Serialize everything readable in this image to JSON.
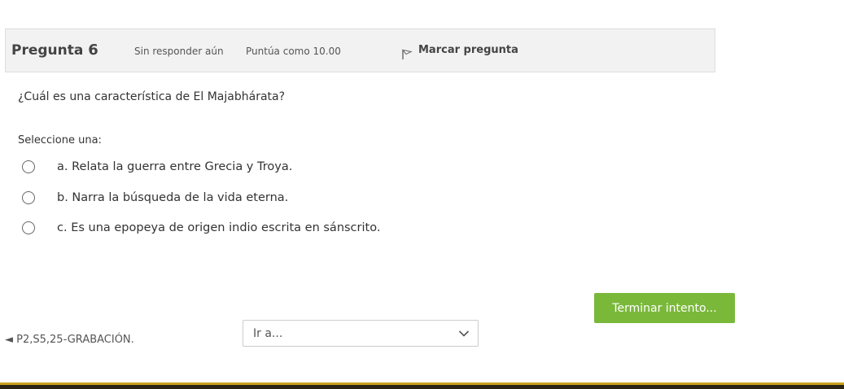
{
  "question": {
    "label": "Pregunta",
    "number": "6",
    "state": "Sin responder aún",
    "grade": "Puntúa como 10.00",
    "flag_label": "Marcar pregunta",
    "text": "¿Cuál es una característica de El Majabhárata?",
    "prompt": "Seleccione una:",
    "options": [
      {
        "label": "a. Relata la guerra entre Grecia y Troya."
      },
      {
        "label": "b. Narra la búsqueda de la vida eterna."
      },
      {
        "label": "c. Es una epopeya de origen indio escrita en sánscrito."
      }
    ]
  },
  "navigation": {
    "finish_label": "Terminar intento...",
    "prev_link": "◄ P2,S5,25-GRABACIÓN.",
    "jump_selected": "Ir a..."
  },
  "colors": {
    "accent_button": "#7ab83a",
    "header_bg": "#f2f2f2",
    "footer_gold": "#c9a21a"
  }
}
